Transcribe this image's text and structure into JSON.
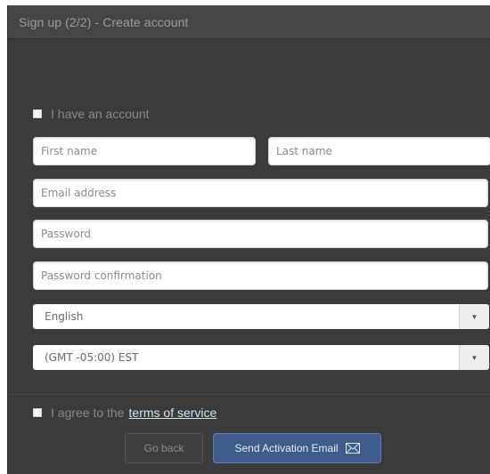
{
  "dialog": {
    "title": "Sign up (2/2) - Create account"
  },
  "have_account": {
    "label": "I have an account",
    "checked": false
  },
  "fields": {
    "first_name_placeholder": "First name",
    "last_name_placeholder": "Last name",
    "email_placeholder": "Email address",
    "password_placeholder": "Password",
    "password_confirmation_placeholder": "Password confirmation"
  },
  "selects": {
    "language_value": "English",
    "timezone_value": "(GMT -05:00) EST",
    "arrow_icon": "caret-down-icon"
  },
  "terms": {
    "label": "I agree to the",
    "link": "terms of service",
    "checked": false
  },
  "buttons": {
    "back_label": "Go back",
    "send_label": "Send Activation Email",
    "send_icon": "envelope-icon"
  },
  "colors": {
    "background": "#3b3b3b",
    "primary_button": "#3e5d8c",
    "link": "#cfe3f0"
  }
}
